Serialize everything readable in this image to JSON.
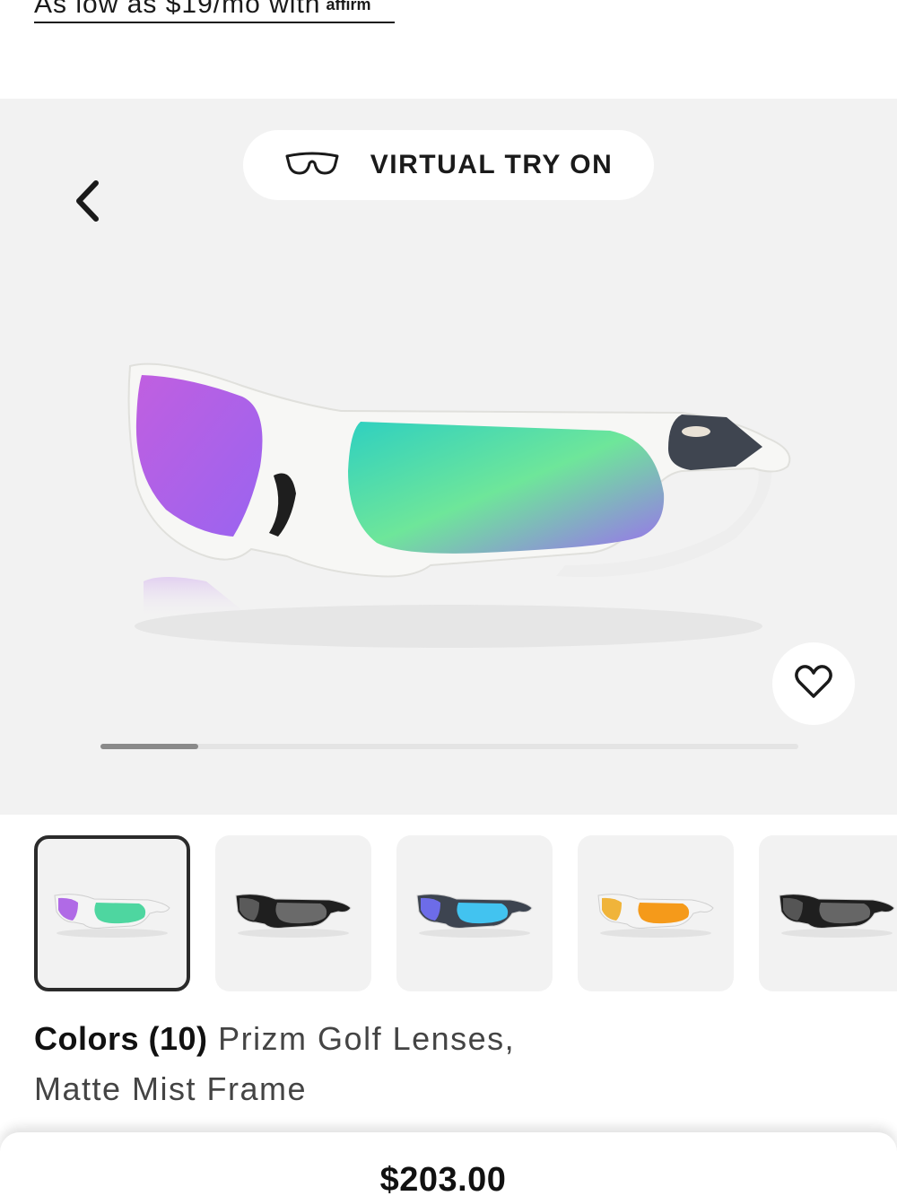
{
  "financing": {
    "text": "As low as $19/mo with",
    "brand": "affirm"
  },
  "gallery": {
    "virtual_try_on_label": "VIRTUAL TRY ON",
    "back_icon": "chevron-left-icon",
    "favorite_icon": "heart-outline-icon",
    "image_progress": 0.14
  },
  "thumbnails": [
    {
      "name": "thumbnail-prizm-golf-matte-mist",
      "lens": "#b06ae6",
      "lens2": "#4ed6a0",
      "frame": "#f4f4f4",
      "selected": true
    },
    {
      "name": "thumbnail-black-prizm",
      "lens": "#5a5a5a",
      "lens2": "#6a6a6a",
      "frame": "#1f1f1f",
      "selected": false
    },
    {
      "name": "thumbnail-sapphire-prizm",
      "lens": "#6d6ce8",
      "lens2": "#42c3f0",
      "frame": "#3d4450",
      "selected": false
    },
    {
      "name": "thumbnail-24k-prizm",
      "lens": "#f0b43a",
      "lens2": "#f59a1a",
      "frame": "#f4f4f4",
      "selected": false
    },
    {
      "name": "thumbnail-black-prizm-alt",
      "lens": "#555555",
      "lens2": "#666666",
      "frame": "#1f1f1f",
      "selected": false
    }
  ],
  "colors": {
    "count_label": "Colors (10)",
    "description": "Prizm Golf Lenses, Matte Mist Frame"
  },
  "price": {
    "amount": "$203.00"
  }
}
